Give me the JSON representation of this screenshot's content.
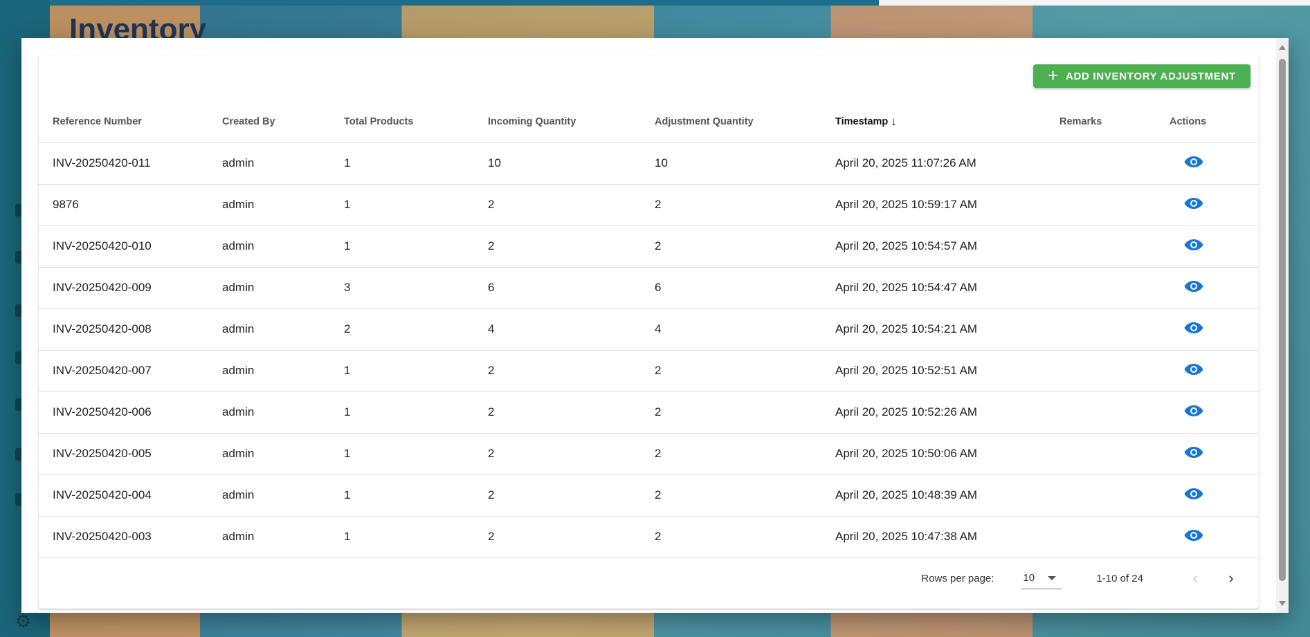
{
  "background": {
    "page_title": "Inventory"
  },
  "toolbar": {
    "add_button_label": "ADD INVENTORY ADJUSTMENT",
    "add_button_icon": "plus-icon"
  },
  "table": {
    "columns": [
      "Reference Number",
      "Created By",
      "Total Products",
      "Incoming Quantity",
      "Adjustment Quantity",
      "Timestamp",
      "Remarks",
      "Actions"
    ],
    "sorted_column": "Timestamp",
    "sort_direction": "descending",
    "rows": [
      {
        "ref": "INV-20250420-011",
        "created_by": "admin",
        "total": "1",
        "incoming": "10",
        "adjustment": "10",
        "timestamp": "April 20, 2025 11:07:26 AM",
        "remarks": ""
      },
      {
        "ref": "9876",
        "created_by": "admin",
        "total": "1",
        "incoming": "2",
        "adjustment": "2",
        "timestamp": "April 20, 2025 10:59:17 AM",
        "remarks": ""
      },
      {
        "ref": "INV-20250420-010",
        "created_by": "admin",
        "total": "1",
        "incoming": "2",
        "adjustment": "2",
        "timestamp": "April 20, 2025 10:54:57 AM",
        "remarks": ""
      },
      {
        "ref": "INV-20250420-009",
        "created_by": "admin",
        "total": "3",
        "incoming": "6",
        "adjustment": "6",
        "timestamp": "April 20, 2025 10:54:47 AM",
        "remarks": ""
      },
      {
        "ref": "INV-20250420-008",
        "created_by": "admin",
        "total": "2",
        "incoming": "4",
        "adjustment": "4",
        "timestamp": "April 20, 2025 10:54:21 AM",
        "remarks": ""
      },
      {
        "ref": "INV-20250420-007",
        "created_by": "admin",
        "total": "1",
        "incoming": "2",
        "adjustment": "2",
        "timestamp": "April 20, 2025 10:52:51 AM",
        "remarks": ""
      },
      {
        "ref": "INV-20250420-006",
        "created_by": "admin",
        "total": "1",
        "incoming": "2",
        "adjustment": "2",
        "timestamp": "April 20, 2025 10:52:26 AM",
        "remarks": ""
      },
      {
        "ref": "INV-20250420-005",
        "created_by": "admin",
        "total": "1",
        "incoming": "2",
        "adjustment": "2",
        "timestamp": "April 20, 2025 10:50:06 AM",
        "remarks": ""
      },
      {
        "ref": "INV-20250420-004",
        "created_by": "admin",
        "total": "1",
        "incoming": "2",
        "adjustment": "2",
        "timestamp": "April 20, 2025 10:48:39 AM",
        "remarks": ""
      },
      {
        "ref": "INV-20250420-003",
        "created_by": "admin",
        "total": "1",
        "incoming": "2",
        "adjustment": "2",
        "timestamp": "April 20, 2025 10:47:38 AM",
        "remarks": ""
      }
    ],
    "row_action_icon": "eye-icon"
  },
  "pagination": {
    "rows_per_page_label": "Rows per page:",
    "rows_per_page_value": "10",
    "range_label": "1-10 of 24"
  },
  "colors": {
    "accent_green": "#4caf50",
    "action_blue": "#1976d2"
  }
}
